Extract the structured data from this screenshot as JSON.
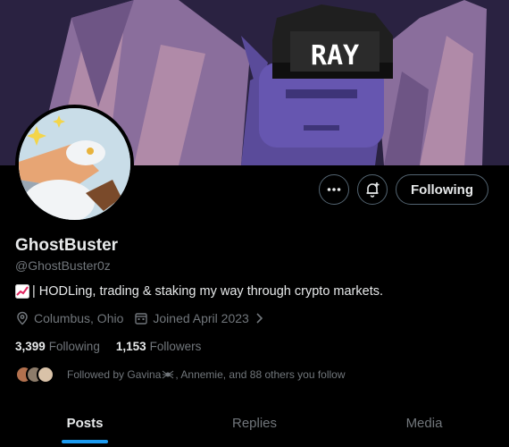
{
  "profile": {
    "name": "GhostBuster",
    "handle": "@GhostBuster0z",
    "bio": "| HODLing, trading & staking my way through crypto markets.",
    "bio_emoji": "chart-increasing-icon",
    "location": "Columbus, Ohio",
    "joined": "Joined April 2023",
    "banner_text": "RAY"
  },
  "actions": {
    "more": "more-icon",
    "notify": "notification-bell-icon",
    "follow_label": "Following"
  },
  "stats": {
    "following_count": "3,399",
    "following_label": "Following",
    "followers_count": "1,153",
    "followers_label": "Followers"
  },
  "followed_by": {
    "text_prefix": "Followed by Gavina",
    "text_suffix": ", Annemie, and 88 others you follow"
  },
  "tabs": [
    {
      "label": "Posts",
      "active": true
    },
    {
      "label": "Replies",
      "active": false
    },
    {
      "label": "Media",
      "active": false
    }
  ],
  "colors": {
    "accent": "#1d9bf0",
    "muted": "#71767b",
    "text": "#e7e9ea",
    "background": "#000000"
  }
}
